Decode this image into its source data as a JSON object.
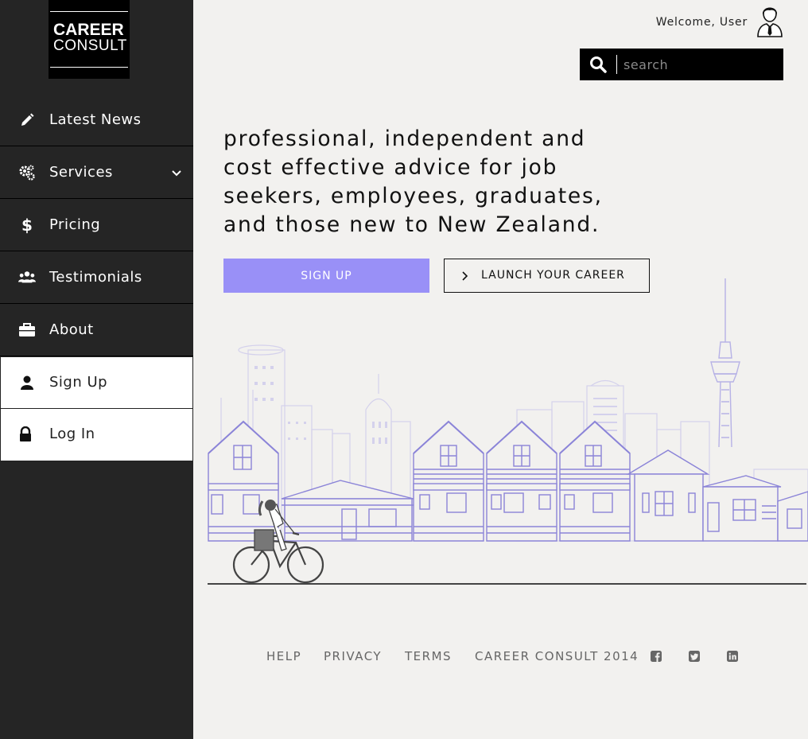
{
  "brand": {
    "line1": "CAREER",
    "line2": "CONSULT"
  },
  "sidebar": {
    "items": [
      {
        "label": "Latest News",
        "icon": "pencil-icon"
      },
      {
        "label": "Services",
        "icon": "gears-icon",
        "has_submenu": true
      },
      {
        "label": "Pricing",
        "icon": "dollar-icon"
      },
      {
        "label": "Testimonials",
        "icon": "users-icon"
      },
      {
        "label": "About",
        "icon": "briefcase-icon"
      },
      {
        "label": "Sign Up",
        "icon": "user-icon"
      },
      {
        "label": "Log In",
        "icon": "lock-icon"
      }
    ]
  },
  "header": {
    "welcome": "Welcome, User",
    "search_placeholder": "search"
  },
  "hero": {
    "headline": "professional, independent and cost effective advice for job seekers, employees, graduates, and those new to New Zealand.",
    "signup_label": "SIGN UP",
    "launch_label": "LAUNCH YOUR CAREER"
  },
  "footer": {
    "links": [
      "HELP",
      "PRIVACY",
      "TERMS",
      "CAREER CONSULT 2014"
    ],
    "social": [
      "facebook-icon",
      "twitter-icon",
      "linkedin-icon"
    ]
  },
  "colors": {
    "sidebar_bg": "#252525",
    "page_bg": "#f2f1ef",
    "accent": "#9990f7",
    "illustration": "#8b84d8"
  }
}
